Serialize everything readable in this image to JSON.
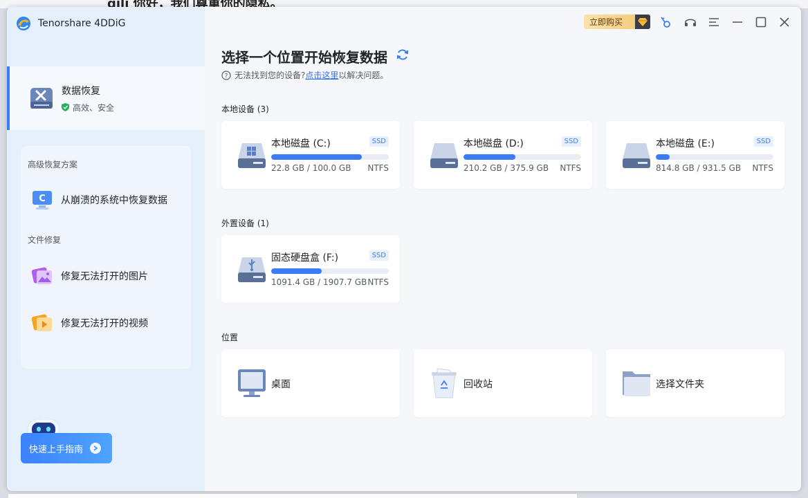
{
  "background": {
    "partial_text": "qili 你好，我们尊重你的隐私。"
  },
  "app": {
    "name": "Tenorshare 4DDiG"
  },
  "sidebar": {
    "main_item": {
      "title": "数据恢复",
      "subtitle": "高效、安全"
    },
    "advanced_header": "高级恢复方案",
    "crash_item": "从崩溃的系统中恢复数据",
    "file_repair_header": "文件修复",
    "photo_item": "修复无法打开的图片",
    "video_item": "修复无法打开的视频",
    "guide_button": "快速上手指南"
  },
  "titlebar": {
    "buy_label": "立即购买",
    "icons": [
      "diamond-icon",
      "key-icon",
      "headset-icon",
      "menu-icon",
      "minimize-icon",
      "maximize-icon",
      "close-icon"
    ]
  },
  "main": {
    "title": "选择一个位置开始恢复数据",
    "help_prefix": "无法找到您的设备?",
    "help_link": "点击这里",
    "help_suffix": "以解决问题。",
    "local_label": "本地设备 (3)",
    "external_label": "外置设备 (1)",
    "location_label": "位置",
    "local_drives": [
      {
        "name": "本地磁盘 (C:)",
        "badge": "SSD",
        "size": "22.8 GB / 100.0 GB",
        "fs": "NTFS",
        "used_fraction": 0.77
      },
      {
        "name": "本地磁盘 (D:)",
        "badge": "SSD",
        "size": "210.2 GB / 375.9 GB",
        "fs": "NTFS",
        "used_fraction": 0.44
      },
      {
        "name": "本地磁盘 (E:)",
        "badge": "SSD",
        "size": "814.8 GB / 931.5 GB",
        "fs": "NTFS",
        "used_fraction": 0.12
      }
    ],
    "external_drives": [
      {
        "name": "固态硬盘盒 (F:)",
        "badge": "SSD",
        "size": "1091.4 GB / 1907.7 GB",
        "fs": "NTFS",
        "used_fraction": 0.43
      }
    ],
    "locations": [
      {
        "name": "桌面"
      },
      {
        "name": "回收站"
      },
      {
        "name": "选择文件夹"
      }
    ]
  },
  "colors": {
    "accent": "#3b7cf6",
    "sidebar_bg": "#e6f0fc",
    "content_bg": "#f5f7fa"
  }
}
